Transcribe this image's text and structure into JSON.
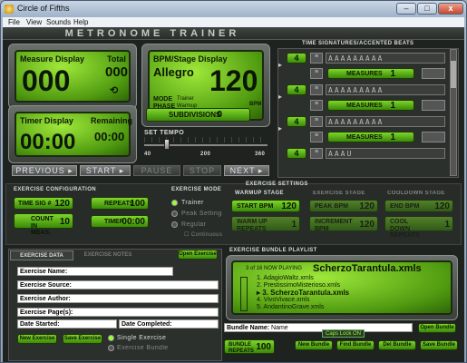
{
  "window": {
    "title": "Circle of Fifths",
    "min": "–",
    "max": "□",
    "close": "x"
  },
  "menu": [
    "File",
    "View",
    "Sounds",
    "Help"
  ],
  "header": {
    "title": "METRONOME TRAINER"
  },
  "measure": {
    "label": "Measure Display",
    "total_label": "Total",
    "value": "000",
    "total": "000"
  },
  "bpm": {
    "label": "BPM/Stage Display",
    "tempo_name": "Allegro",
    "value": "120",
    "unit": "BPM",
    "mode_label": "MODE",
    "mode": "Trainer",
    "phase_label": "PHASE",
    "phase": "Warmup"
  },
  "timer": {
    "label": "Timer Display",
    "remaining_label": "Remaining",
    "value": "00:00",
    "remaining": "00:00"
  },
  "subdivisions": {
    "label": "SUBDIVISIONS",
    "value": "0"
  },
  "set_tempo": {
    "label": "SET TEMPO",
    "ticks": [
      "40",
      "200",
      "360"
    ],
    "level": 0.17
  },
  "nav": [
    "PREVIOUS",
    "START",
    "PAUSE",
    "STOP",
    "NEXT"
  ],
  "time_sig": {
    "title": "TIME SIGNATURES/ACCENTED BEATS",
    "rows": [
      {
        "sig": "4",
        "accents": "AAAAAAAAA",
        "measures_label": "MEASURES",
        "measures": "1"
      },
      {
        "sig": "4",
        "accents": "AAAAAAAAA",
        "measures_label": "MEASURES",
        "measures": "1"
      },
      {
        "sig": "4",
        "accents": "AAAAAAAAA",
        "measures_label": "MEASURES",
        "measures": "1"
      },
      {
        "sig": "4",
        "accents": "AAAU",
        "measures_label": "MEASURES",
        "measures": "1"
      }
    ]
  },
  "exercise_config": {
    "title": "EXERCISE CONFIGURATION",
    "time_sig_label": "TIME SIG #",
    "time_sig": "120",
    "repeats_label": "REPEATS",
    "repeats": "100",
    "count_label": "COUNT IN MEAS.",
    "count": "10",
    "timer_label": "TIMER",
    "timer": "00:00"
  },
  "exercise_mode": {
    "title": "EXERCISE MODE",
    "options": [
      "Trainer",
      "Peak Setting",
      "Regular"
    ],
    "continuous": "Continuous"
  },
  "exercise_settings": {
    "title": "EXERCISE SETTINGS",
    "warmup": "WARMUP STAGE",
    "exercise": "EXERCISE STAGE",
    "cooldown": "COOLDOWN STAGE",
    "start_bpm_label": "START BPM",
    "start_bpm": "120",
    "peak_bpm_label": "PEAK BPM",
    "peak_bpm": "120",
    "end_bpm_label": "END BPM",
    "end_bpm": "120",
    "warmup_repeats_label": "WARM UP REPEATS",
    "warmup_repeats": "1",
    "increment_label": "INCREMENT BPM",
    "increment": "120",
    "cool_repeats_label": "COOL DOWN REPEATS",
    "cool_repeats": "1"
  },
  "exercise_data": {
    "tab1": "EXERCISE DATA",
    "tab2": "EXERCISE NOTES",
    "open_exercise": "Open Exercise",
    "name_label": "Exercise Name:",
    "source_label": "Exercise Source:",
    "author_label": "Exercise Author:",
    "pages_label": "Exercise Page(s):",
    "date_started": "Date Started:",
    "date_completed": "Date Completed:",
    "new_exercise": "New Exercise",
    "save_exercise": "Save Exercise",
    "single": "Single Exercise",
    "bundle": "Exercise Bundle"
  },
  "playlist": {
    "title": "EXERCISE BUNDLE PLAYLIST",
    "now_playing": "3 of 16 NOW PLAYING",
    "current": "ScherzoTarantula.xmls",
    "items": [
      "1. AdagioWaltz.xmls",
      "2. PrestissimoMisterioso.xmls",
      "3. ScherzoTarantula.xmls",
      "4. VivoVivace.xmls",
      "5. AndantinoGrave.xmls"
    ],
    "bundle_name_label": "Bundle Name:",
    "bundle_name": "Name",
    "caps_lock": "Caps Lock ON",
    "open_bundle": "Open Bundle",
    "bundle_repeats_label": "BUNDLE REPEATS",
    "bundle_repeats": "100",
    "new_bundle": "New Bundle",
    "find_bundle": "Find Bundle",
    "del_bundle": "Del Bundle",
    "save_bundle": "Save Bundle"
  }
}
